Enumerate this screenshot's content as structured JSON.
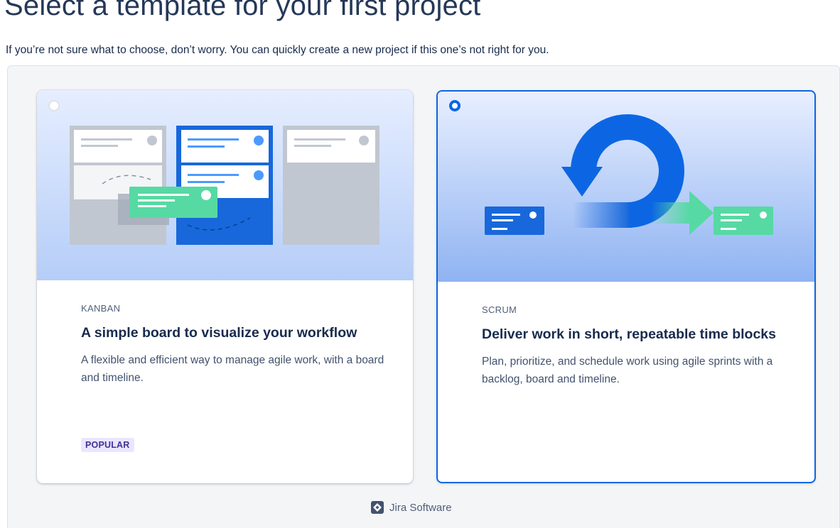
{
  "header": {
    "title": "Select a template for your first project",
    "subtitle": "If you’re not sure what to choose, don’t worry. You can quickly create a new project if this one’s not right for you."
  },
  "templates": [
    {
      "kind": "KANBAN",
      "heading": "A simple board to visualize your workflow",
      "description": "A flexible and efficient way to manage agile work, with a board and timeline.",
      "badge": "POPULAR",
      "selected": false
    },
    {
      "kind": "SCRUM",
      "heading": "Deliver work in short, repeatable time blocks",
      "description": "Plan, prioritize, and schedule work using agile sprints with a backlog, board and timeline.",
      "selected": true
    }
  ],
  "footer": {
    "brand": "Jira Software",
    "icon": "jira-logo-icon"
  },
  "colors": {
    "accent": "#0c66e4",
    "card_blue": "#1868db",
    "green": "#57d9a3",
    "badge_bg": "#eae6ff",
    "badge_fg": "#403294"
  }
}
